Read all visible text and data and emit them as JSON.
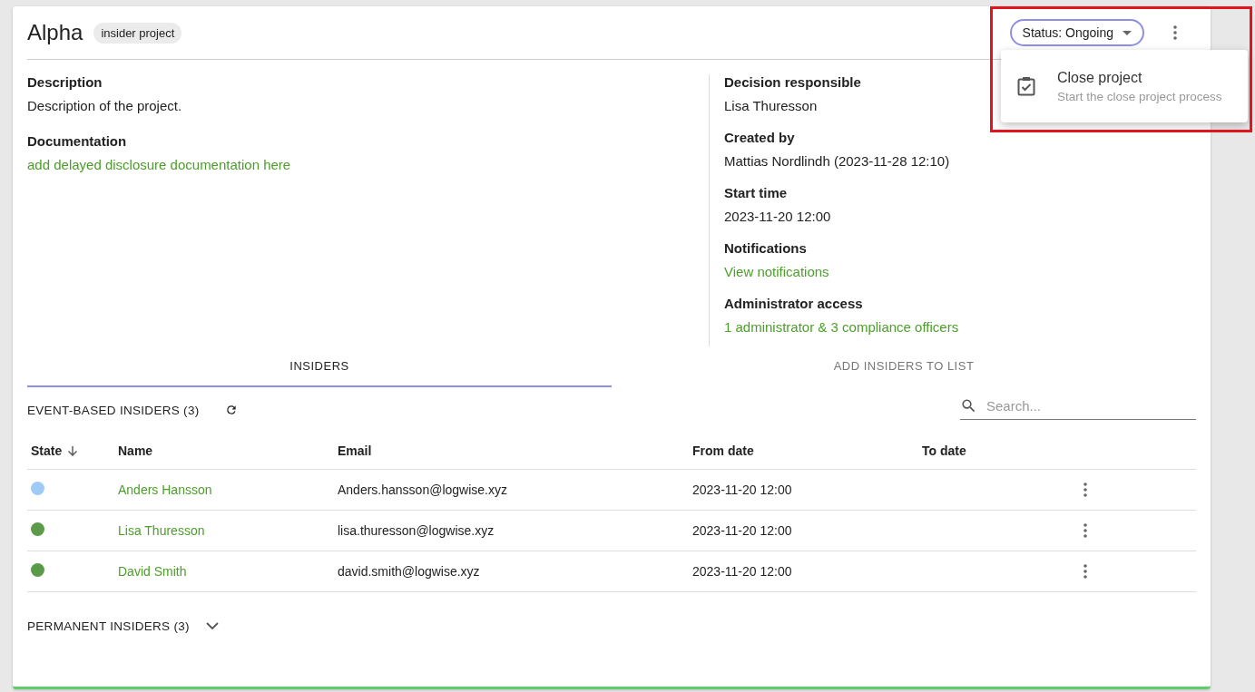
{
  "header": {
    "title": "Alpha",
    "tag": "insider project",
    "status_button": "Status: Ongoing"
  },
  "menu": {
    "items": [
      {
        "label": "Close project",
        "description": "Start the close project process"
      }
    ]
  },
  "details_left": [
    {
      "label": "Description",
      "value": "Description of the project.",
      "kind": "text"
    },
    {
      "label": "Documentation",
      "value": "add delayed disclosure documentation here",
      "kind": "link"
    }
  ],
  "details_right": [
    {
      "label": "Decision responsible",
      "value": "Lisa Thuresson",
      "kind": "text"
    },
    {
      "label": "Created by",
      "value": "Mattias Nordlindh (2023-11-28 12:10)",
      "kind": "text"
    },
    {
      "label": "Start time",
      "value": "2023-11-20 12:00",
      "kind": "text"
    },
    {
      "label": "Notifications",
      "value": "View notifications",
      "kind": "link"
    },
    {
      "label": "Administrator access",
      "value": "1 administrator & 3 compliance officers",
      "kind": "link"
    }
  ],
  "tabs": [
    {
      "label": "INSIDERS",
      "selected": true
    },
    {
      "label": "ADD INSIDERS TO LIST",
      "selected": false
    }
  ],
  "event_section": {
    "title": "EVENT-BASED INSIDERS (3)",
    "search": {
      "placeholder": "Search..."
    }
  },
  "table": {
    "columns": [
      {
        "label": "State",
        "sorted": true
      },
      {
        "label": "Name",
        "sorted": false
      },
      {
        "label": "Email",
        "sorted": false
      },
      {
        "label": "From date",
        "sorted": false
      },
      {
        "label": "To date",
        "sorted": false
      }
    ],
    "rows": [
      {
        "color": "#9ecbf5",
        "name": "Anders Hansson",
        "email": "Anders.hansson@logwise.xyz",
        "from_date": "2023-11-20 12:00"
      },
      {
        "color": "#5a9a48",
        "name": "Lisa Thuresson",
        "email": "lisa.thuresson@logwise.xyz",
        "from_date": "2023-11-20 12:00"
      },
      {
        "color": "#5a9a48",
        "name": "David Smith",
        "email": "david.smith@logwise.xyz",
        "from_date": "2023-11-20 12:00"
      }
    ]
  },
  "permanent_section": {
    "title": "PERMANENT INSIDERS (3)",
    "expanded": false
  }
}
